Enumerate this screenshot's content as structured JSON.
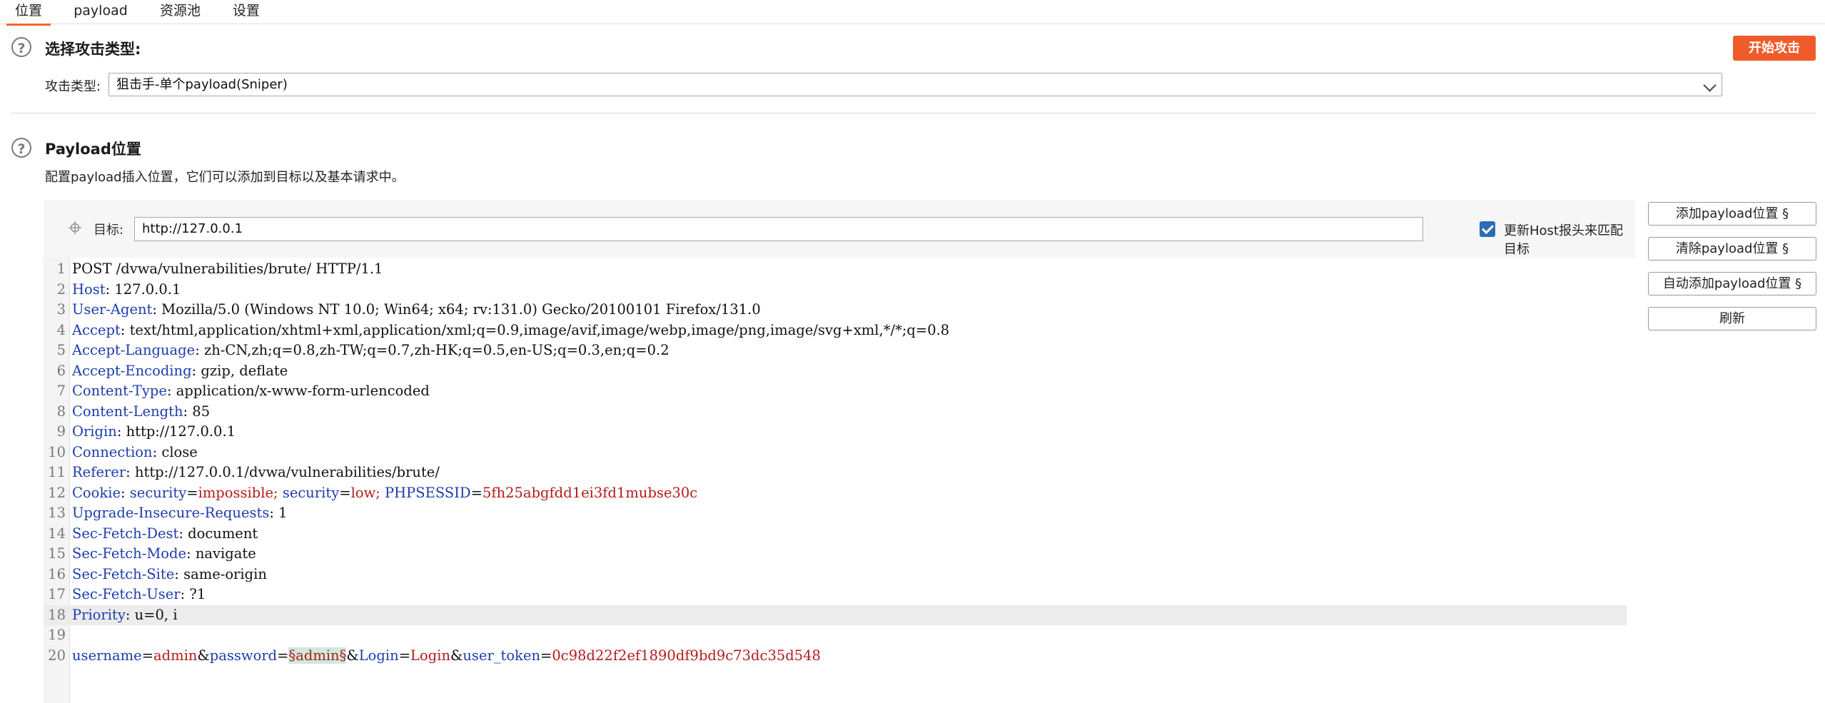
{
  "tabs": [
    "位置",
    "payload",
    "资源池",
    "设置"
  ],
  "attack_type_section": {
    "title": "选择攻击类型:",
    "label": "攻击类型:",
    "selected": "狙击手-单个payload(Sniper)",
    "start_button": "开始攻击"
  },
  "payload_section": {
    "title": "Payload位置",
    "description": "配置payload插入位置，它们可以添加到目标以及基本请求中。",
    "target_label": "目标:",
    "target_value": "http://127.0.0.1",
    "update_host_label": "更新Host报头来匹配目标",
    "update_host_checked": true
  },
  "side_buttons": [
    "添加payload位置 §",
    "清除payload位置 §",
    "自动添加payload位置 §",
    "刷新"
  ],
  "request_lines": [
    {
      "n": "1",
      "parts": [
        {
          "t": "POST /dvwa/vulnerabilities/brute/ HTTP/1.1",
          "c": "v"
        }
      ]
    },
    {
      "n": "2",
      "parts": [
        {
          "t": "Host",
          "c": "k"
        },
        {
          "t": ": 127.0.0.1",
          "c": "v"
        }
      ]
    },
    {
      "n": "3",
      "parts": [
        {
          "t": "User-Agent",
          "c": "k"
        },
        {
          "t": ": Mozilla/5.0 (Windows NT 10.0; Win64; x64; rv:131.0) Gecko/20100101 Firefox/131.0",
          "c": "v"
        }
      ]
    },
    {
      "n": "4",
      "parts": [
        {
          "t": "Accept",
          "c": "k"
        },
        {
          "t": ": text/html,application/xhtml+xml,application/xml;q=0.9,image/avif,image/webp,image/png,image/svg+xml,*/*;q=0.8",
          "c": "v"
        }
      ]
    },
    {
      "n": "5",
      "parts": [
        {
          "t": "Accept-Language",
          "c": "k"
        },
        {
          "t": ": zh-CN,zh;q=0.8,zh-TW;q=0.7,zh-HK;q=0.5,en-US;q=0.3,en;q=0.2",
          "c": "v"
        }
      ]
    },
    {
      "n": "6",
      "parts": [
        {
          "t": "Accept-Encoding",
          "c": "k"
        },
        {
          "t": ": gzip, deflate",
          "c": "v"
        }
      ]
    },
    {
      "n": "7",
      "parts": [
        {
          "t": "Content-Type",
          "c": "k"
        },
        {
          "t": ": application/x-www-form-urlencoded",
          "c": "v"
        }
      ]
    },
    {
      "n": "8",
      "parts": [
        {
          "t": "Content-Length",
          "c": "k"
        },
        {
          "t": ": 85",
          "c": "v"
        }
      ]
    },
    {
      "n": "9",
      "parts": [
        {
          "t": "Origin",
          "c": "k"
        },
        {
          "t": ": http://127.0.0.1",
          "c": "v"
        }
      ]
    },
    {
      "n": "10",
      "parts": [
        {
          "t": "Connection",
          "c": "k"
        },
        {
          "t": ": close",
          "c": "v"
        }
      ]
    },
    {
      "n": "11",
      "parts": [
        {
          "t": "Referer",
          "c": "k"
        },
        {
          "t": ": http://127.0.0.1/dvwa/vulnerabilities/brute/",
          "c": "v"
        }
      ]
    },
    {
      "n": "12",
      "parts": [
        {
          "t": "Cookie",
          "c": "k"
        },
        {
          "t": ": ",
          "c": "v"
        },
        {
          "t": "security",
          "c": "k"
        },
        {
          "t": "=",
          "c": "v"
        },
        {
          "t": "impossible; ",
          "c": "r"
        },
        {
          "t": "security",
          "c": "k"
        },
        {
          "t": "=",
          "c": "v"
        },
        {
          "t": "low; ",
          "c": "r"
        },
        {
          "t": "PHPSESSID",
          "c": "k"
        },
        {
          "t": "=",
          "c": "v"
        },
        {
          "t": "5fh25abgfdd1ei3fd1mubse30c",
          "c": "r"
        }
      ]
    },
    {
      "n": "13",
      "parts": [
        {
          "t": "Upgrade-Insecure-Requests",
          "c": "k"
        },
        {
          "t": ": 1",
          "c": "v"
        }
      ]
    },
    {
      "n": "14",
      "parts": [
        {
          "t": "Sec-Fetch-Dest",
          "c": "k"
        },
        {
          "t": ": document",
          "c": "v"
        }
      ]
    },
    {
      "n": "15",
      "parts": [
        {
          "t": "Sec-Fetch-Mode",
          "c": "k"
        },
        {
          "t": ": navigate",
          "c": "v"
        }
      ]
    },
    {
      "n": "16",
      "parts": [
        {
          "t": "Sec-Fetch-Site",
          "c": "k"
        },
        {
          "t": ": same-origin",
          "c": "v"
        }
      ]
    },
    {
      "n": "17",
      "parts": [
        {
          "t": "Sec-Fetch-User",
          "c": "k"
        },
        {
          "t": ": ?1",
          "c": "v"
        }
      ]
    },
    {
      "n": "18",
      "parts": [
        {
          "t": "Priority",
          "c": "k"
        },
        {
          "t": ": u=0, i",
          "c": "v"
        }
      ],
      "highlight": true
    },
    {
      "n": "19",
      "parts": []
    },
    {
      "n": "20",
      "parts": [
        {
          "t": "username",
          "c": "k"
        },
        {
          "t": "=",
          "c": "v"
        },
        {
          "t": "admin",
          "c": "r"
        },
        {
          "t": "&",
          "c": "v"
        },
        {
          "t": "password",
          "c": "k"
        },
        {
          "t": "=",
          "c": "v"
        },
        {
          "t": "§admin§",
          "c": "pl"
        },
        {
          "t": "&",
          "c": "v"
        },
        {
          "t": "Login",
          "c": "k"
        },
        {
          "t": "=",
          "c": "v"
        },
        {
          "t": "Login",
          "c": "r"
        },
        {
          "t": "&",
          "c": "v"
        },
        {
          "t": "user_token",
          "c": "k"
        },
        {
          "t": "=",
          "c": "v"
        },
        {
          "t": "0c98d22f2ef1890df9bd9c73dc35d548",
          "c": "r"
        }
      ]
    }
  ]
}
